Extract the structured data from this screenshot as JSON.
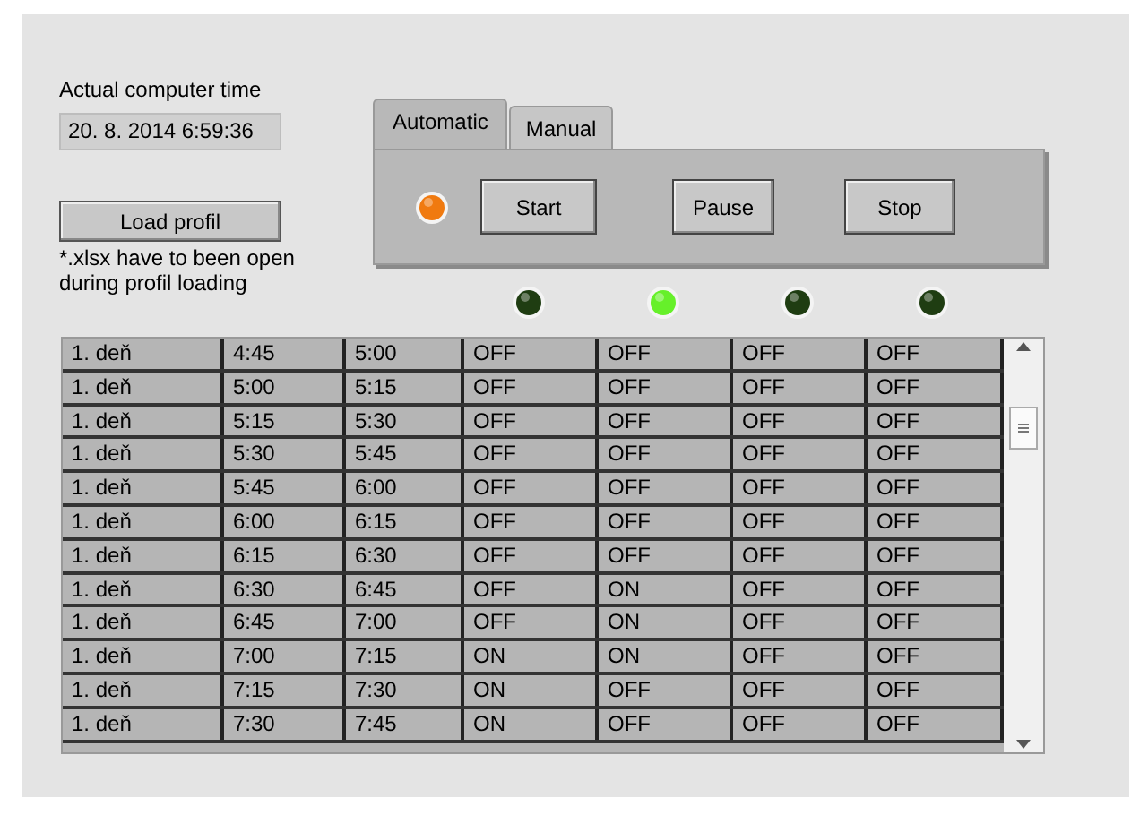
{
  "time_label": "Actual computer time",
  "time_value": "20. 8. 2014 6:59:36",
  "load_button": "Load profil",
  "note": "*.xlsx have to been open during profil loading",
  "tabs": [
    {
      "label": "Automatic",
      "selected": true
    },
    {
      "label": "Manual",
      "selected": false
    }
  ],
  "status_led": {
    "on": true
  },
  "buttons": [
    "Start",
    "Pause",
    "Stop"
  ],
  "leds": [
    {
      "on": false
    },
    {
      "on": true
    },
    {
      "on": false
    },
    {
      "on": false
    }
  ],
  "table": {
    "rows": [
      [
        "1. deň",
        "4:45",
        "5:00",
        "OFF",
        "OFF",
        "OFF",
        "OFF"
      ],
      [
        "1. deň",
        "5:00",
        "5:15",
        "OFF",
        "OFF",
        "OFF",
        "OFF"
      ],
      [
        "1. deň",
        "5:15",
        "5:30",
        "OFF",
        "OFF",
        "OFF",
        "OFF"
      ],
      [
        "1. deň",
        "5:30",
        "5:45",
        "OFF",
        "OFF",
        "OFF",
        "OFF"
      ],
      [
        "1. deň",
        "5:45",
        "6:00",
        "OFF",
        "OFF",
        "OFF",
        "OFF"
      ],
      [
        "1. deň",
        "6:00",
        "6:15",
        "OFF",
        "OFF",
        "OFF",
        "OFF"
      ],
      [
        "1. deň",
        "6:15",
        "6:30",
        "OFF",
        "OFF",
        "OFF",
        "OFF"
      ],
      [
        "1. deň",
        "6:30",
        "6:45",
        "OFF",
        "ON",
        "OFF",
        "OFF"
      ],
      [
        "1. deň",
        "6:45",
        "7:00",
        "OFF",
        "ON",
        "OFF",
        "OFF"
      ],
      [
        "1. deň",
        "7:00",
        "7:15",
        "ON",
        "ON",
        "OFF",
        "OFF"
      ],
      [
        "1. deň",
        "7:15",
        "7:30",
        "ON",
        "OFF",
        "OFF",
        "OFF"
      ],
      [
        "1. deň",
        "7:30",
        "7:45",
        "ON",
        "OFF",
        "OFF",
        "OFF"
      ]
    ]
  }
}
